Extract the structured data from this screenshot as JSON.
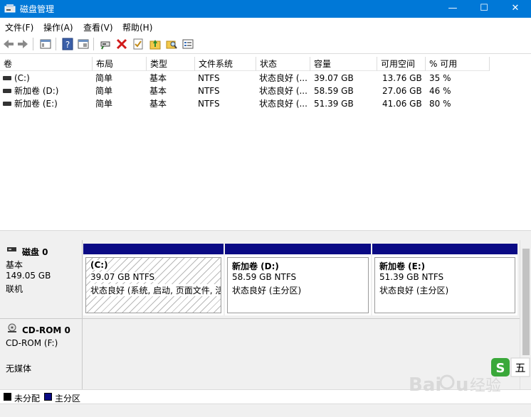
{
  "window": {
    "title": "磁盘管理",
    "minimize": "—",
    "maximize": "☐",
    "close": "✕"
  },
  "menu": {
    "items": [
      "文件(F)",
      "操作(A)",
      "查看(V)",
      "帮助(H)"
    ]
  },
  "toolbar": {
    "icons": [
      "back-arrow-icon",
      "forward-arrow-icon",
      "show-hide-tree-icon",
      "help-icon",
      "properties-icon",
      "connect-icon",
      "delete-icon",
      "check-icon",
      "folder-up-icon",
      "search-folder-icon",
      "view-list-icon"
    ]
  },
  "volume_list": {
    "columns": [
      "卷",
      "布局",
      "类型",
      "文件系统",
      "状态",
      "容量",
      "可用空间",
      "% 可用"
    ],
    "rows": [
      {
        "name": "(C:)",
        "layout": "简单",
        "type": "基本",
        "fs": "NTFS",
        "status": "状态良好 (...",
        "capacity": "39.07 GB",
        "free": "13.76 GB",
        "pct": "35 %"
      },
      {
        "name": "新加卷 (D:)",
        "layout": "简单",
        "type": "基本",
        "fs": "NTFS",
        "status": "状态良好 (...",
        "capacity": "58.59 GB",
        "free": "27.06 GB",
        "pct": "46 %"
      },
      {
        "name": "新加卷 (E:)",
        "layout": "简单",
        "type": "基本",
        "fs": "NTFS",
        "status": "状态良好 (...",
        "capacity": "51.39 GB",
        "free": "41.06 GB",
        "pct": "80 %"
      }
    ]
  },
  "disks": [
    {
      "name": "磁盘 0",
      "kind": "基本",
      "size": "149.05 GB",
      "state": "联机",
      "partitions": [
        {
          "title": "(C:)",
          "size": "39.07 GB NTFS",
          "status": "状态良好 (系统, 启动, 页面文件, 活"
        },
        {
          "title": "新加卷  (D:)",
          "size": "58.59 GB NTFS",
          "status": "状态良好 (主分区)"
        },
        {
          "title": "新加卷  (E:)",
          "size": "51.39 GB NTFS",
          "status": "状态良好 (主分区)"
        }
      ]
    },
    {
      "name": "CD-ROM 0",
      "kind": "CD-ROM (F:)",
      "media": "无媒体"
    }
  ],
  "legend": [
    {
      "label": "未分配",
      "color": "#000000"
    },
    {
      "label": "主分区",
      "color": "#0a0a84"
    }
  ],
  "watermark": {
    "brand": "Baidu 经验",
    "ime": "五"
  }
}
